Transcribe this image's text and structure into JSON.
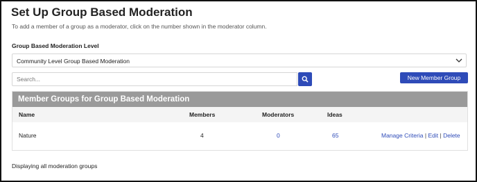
{
  "page": {
    "title": "Set Up Group Based Moderation",
    "description": "To add a member of a group as a moderator, click on the number shown in the moderator column.",
    "level_label": "Group Based Moderation Level",
    "level_selected": "Community Level Group Based Moderation",
    "search_placeholder": "Search...",
    "new_button": "New Member Group",
    "footer": "Displaying all moderation groups"
  },
  "table": {
    "title": "Member Groups for Group Based Moderation",
    "columns": [
      "Name",
      "Members",
      "Moderators",
      "Ideas"
    ],
    "rows": [
      {
        "name": "Nature",
        "members": "4",
        "moderators": "0",
        "ideas": "65",
        "actions": [
          "Manage Criteria",
          "Edit",
          "Delete"
        ]
      }
    ]
  },
  "icons": {
    "search_button": "search-icon",
    "select_chevron": "chevron-down-icon"
  },
  "colors": {
    "accent": "#2e4bb8",
    "panel_header": "#9a9a9a"
  }
}
